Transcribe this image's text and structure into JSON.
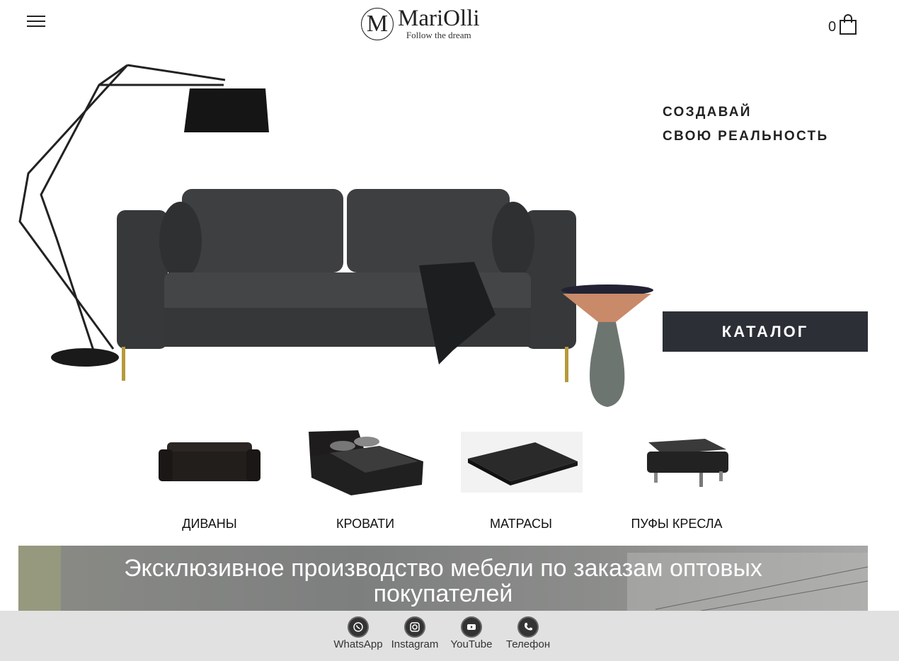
{
  "header": {
    "logo_mark": "M",
    "logo_name": "MariOlli",
    "logo_tagline": "Follow the dream",
    "cart_count": "0"
  },
  "hero": {
    "slogan_line1": "СОЗДАВАЙ",
    "slogan_line2": "СВОЮ РЕАЛЬНОСТЬ",
    "catalog_button": "КАТАЛОГ"
  },
  "categories": [
    {
      "label": "ДИВАНЫ"
    },
    {
      "label": "КРОВАТИ"
    },
    {
      "label": "МАТРАСЫ"
    },
    {
      "label": "ПУФЫ КРЕСЛА"
    }
  ],
  "banner": {
    "text": "Эксклюзивное производство мебели по заказам оптовых покупателей"
  },
  "social": [
    {
      "label": "WhatsApp",
      "icon": "whatsapp-icon"
    },
    {
      "label": "Instagram",
      "icon": "instagram-icon"
    },
    {
      "label": "YouTube",
      "icon": "youtube-icon"
    },
    {
      "label": "Телефон",
      "icon": "phone-icon"
    }
  ],
  "colors": {
    "catalog_button_bg": "#2c2f36",
    "bottom_bar_bg": "#e1e1e1",
    "sofa": "#3b3d3f"
  }
}
